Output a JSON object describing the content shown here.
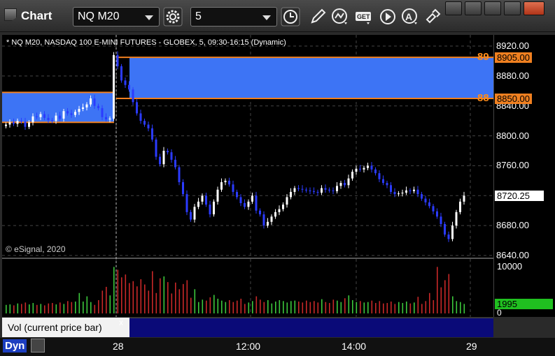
{
  "app": {
    "title": "Chart"
  },
  "toolbar": {
    "symbol": "NQ M20",
    "interval": "5"
  },
  "chart": {
    "title": "* NQ M20, NASDAQ 100 E-MINI FUTURES - GLOBEX, 5, 09:30-16:15 (Dynamic)",
    "copyright": "© eSignal, 2020",
    "y_ticks": [
      "8920.00",
      "8880.00",
      "8840.00",
      "8800.00",
      "8760.00",
      "8720.00",
      "8680.00",
      "8640.00"
    ],
    "level_high": {
      "label": "89",
      "price": "8905.00"
    },
    "level_low": {
      "label": "88",
      "price": "8850.00"
    },
    "last_price": "8720.25"
  },
  "volume": {
    "label": "Vol (current price bar)",
    "close_glyph": "x",
    "ticks": [
      "10000",
      "0"
    ],
    "last": "1995"
  },
  "xaxis": {
    "labels": [
      "28",
      "12:00",
      "14:00",
      "29"
    ]
  },
  "footer": {
    "mode": "Dyn"
  },
  "chart_data": {
    "type": "candlestick",
    "title": "* NQ M20, NASDAQ 100 E-MINI FUTURES - GLOBEX, 5, 09:30-16:15 (Dynamic)",
    "ylim": [
      8640,
      8930
    ],
    "x_ticks": [
      "28",
      "12:00",
      "14:00",
      "29"
    ],
    "levels": [
      8905.0,
      8850.0
    ],
    "last": 8720.25,
    "closes": [
      8815,
      8818,
      8816,
      8820,
      8819,
      8812,
      8818,
      8826,
      8825,
      8829,
      8824,
      8821,
      8820,
      8827,
      8823,
      8833,
      8830,
      8828,
      8832,
      8836,
      8838,
      8842,
      8850,
      8840,
      8837,
      8825,
      8822,
      8823,
      8908,
      8893,
      8874,
      8868,
      8862,
      8845,
      8830,
      8820,
      8815,
      8810,
      8795,
      8772,
      8762,
      8780,
      8778,
      8768,
      8758,
      8738,
      8722,
      8698,
      8688,
      8705,
      8712,
      8720,
      8708,
      8695,
      8712,
      8728,
      8738,
      8740,
      8735,
      8725,
      8718,
      8710,
      8705,
      8712,
      8720,
      8700,
      8695,
      8680,
      8685,
      8692,
      8698,
      8702,
      8708,
      8718,
      8725,
      8730,
      8729,
      8728,
      8727,
      8726,
      8725,
      8724,
      8730,
      8728,
      8727,
      8726,
      8733,
      8737,
      8734,
      8743,
      8752,
      8756,
      8755,
      8757,
      8760,
      8755,
      8750,
      8742,
      8737,
      8734,
      8725,
      8722,
      8723,
      8724,
      8727,
      8726,
      8728,
      8722,
      8716,
      8711,
      8706,
      8699,
      8692,
      8682,
      8668,
      8662,
      8680,
      8698,
      8712,
      8720
    ],
    "volume": [
      1800,
      1900,
      1700,
      2100,
      2000,
      2300,
      1900,
      2200,
      1800,
      2000,
      1700,
      2100,
      2200,
      1900,
      2300,
      2000,
      2600,
      2400,
      2500,
      4300,
      2500,
      3600,
      2400,
      1800,
      2800,
      4800,
      5600,
      3800,
      9800,
      9200,
      7600,
      8200,
      6400,
      6800,
      5700,
      7200,
      6100,
      4800,
      8900,
      4300,
      7400,
      7800,
      6600,
      4200,
      6500,
      5100,
      6200,
      7000,
      3300,
      5100,
      2400,
      2900,
      2700,
      3400,
      3900,
      3100,
      2700,
      2400,
      2800,
      2400,
      2700,
      3100,
      2000,
      2300,
      2600,
      3600,
      2900,
      2400,
      2800,
      2100,
      2500,
      2800,
      2600,
      2300,
      2600,
      2700,
      2500,
      2300,
      2700,
      2400,
      2600,
      2300,
      3000,
      2400,
      2200,
      2900,
      2700,
      2400,
      3200,
      3800,
      2800,
      2400,
      2600,
      2300,
      2400,
      2700,
      2200,
      2600,
      2100,
      2200,
      2500,
      2000,
      2400,
      2200,
      2500,
      2100,
      2300,
      3500,
      2000,
      2600,
      4300,
      2800,
      9800,
      5500,
      7000,
      8300,
      3600,
      2600,
      2400,
      2000
    ]
  },
  "colors": {
    "band": "#3d74f5",
    "level": "#f08020",
    "up": "#ffffff",
    "down": "#2b3bff",
    "vol_up": "#3cc83c",
    "vol_down": "#c82828"
  }
}
